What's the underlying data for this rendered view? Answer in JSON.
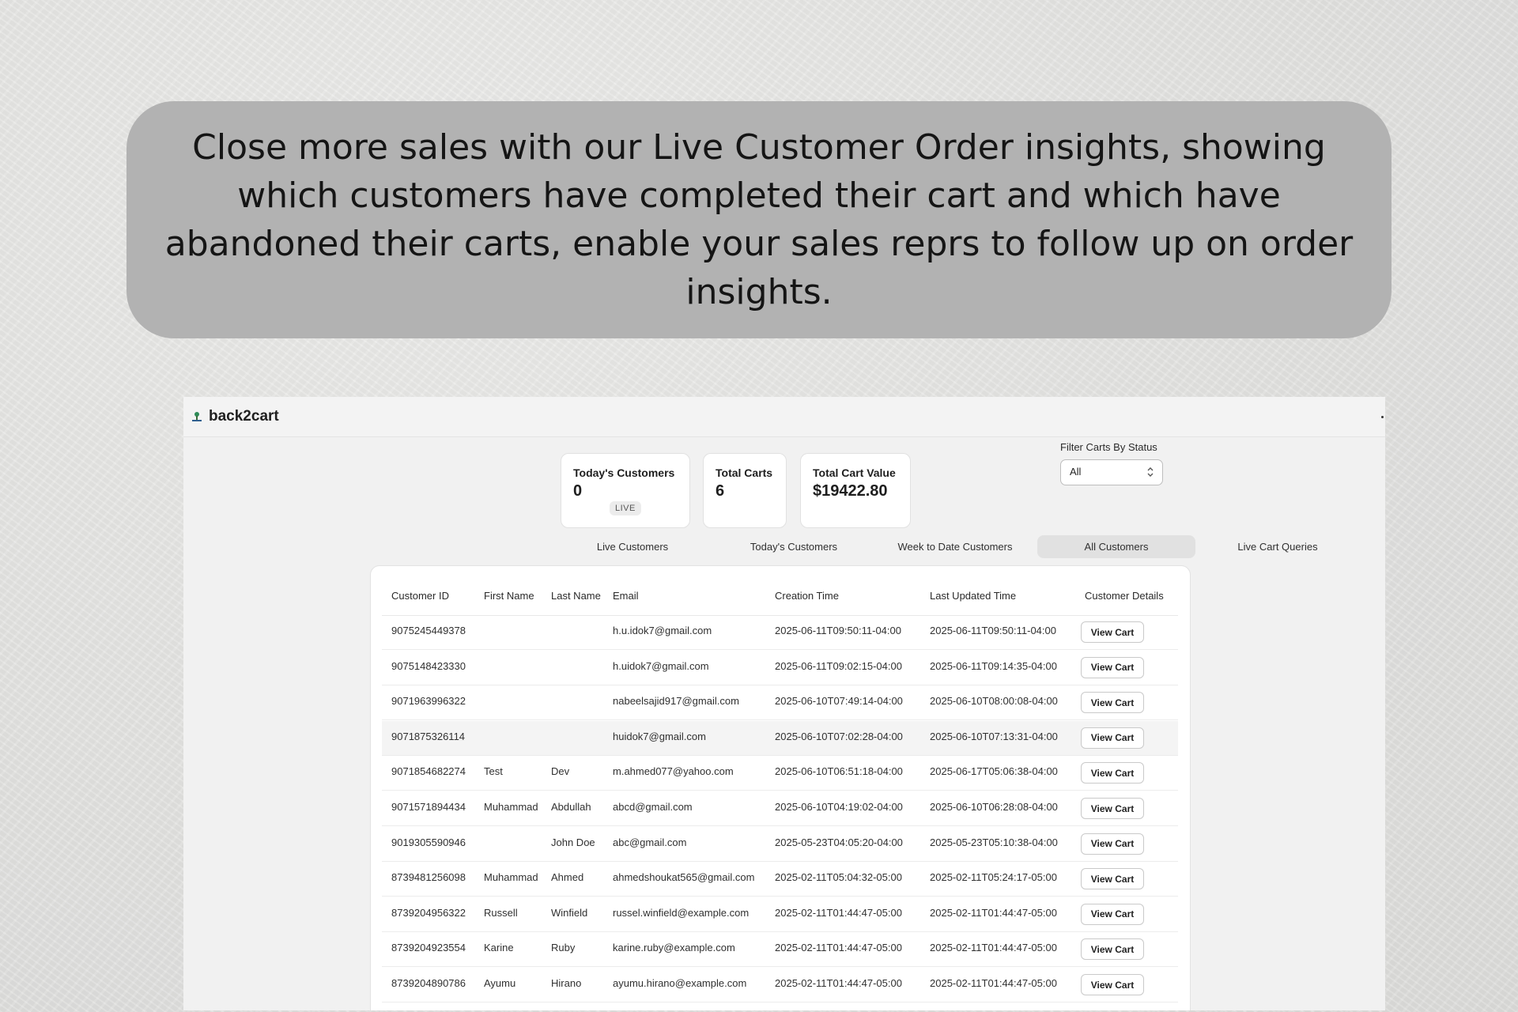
{
  "banner": {
    "text": "Close more sales with our Live Customer Order insights, showing which customers have completed their cart and which have abandoned their carts, enable your sales reprs to follow up on order insights."
  },
  "app": {
    "name": "back2cart",
    "stats": {
      "todays_customers_label": "Today's Customers",
      "todays_customers_value": "0",
      "live_badge": "LIVE",
      "total_carts_label": "Total Carts",
      "total_carts_value": "6",
      "total_cart_value_label": "Total Cart Value",
      "total_cart_value_value": "$19422.80"
    },
    "filter": {
      "label": "Filter Carts By Status",
      "selected": "All"
    },
    "tabs": [
      {
        "label": "Live Customers",
        "active": false
      },
      {
        "label": "Today's Customers",
        "active": false
      },
      {
        "label": "Week to Date Customers",
        "active": false
      },
      {
        "label": "All Customers",
        "active": true
      },
      {
        "label": "Live Cart Queries",
        "active": false
      }
    ],
    "table": {
      "columns": [
        "Customer ID",
        "First Name",
        "Last Name",
        "Email",
        "Creation Time",
        "Last Updated Time",
        "Customer Details"
      ],
      "button_label": "View Cart",
      "rows": [
        {
          "id": "9075245449378",
          "first": "",
          "last": "",
          "email": "h.u.idok7@gmail.com",
          "created": "2025-06-11T09:50:11-04:00",
          "updated": "2025-06-11T09:50:11-04:00"
        },
        {
          "id": "9075148423330",
          "first": "",
          "last": "",
          "email": "h.uidok7@gmail.com",
          "created": "2025-06-11T09:02:15-04:00",
          "updated": "2025-06-11T09:14:35-04:00"
        },
        {
          "id": "9071963996322",
          "first": "",
          "last": "",
          "email": "nabeelsajid917@gmail.com",
          "created": "2025-06-10T07:49:14-04:00",
          "updated": "2025-06-10T08:00:08-04:00"
        },
        {
          "id": "9071875326114",
          "first": "",
          "last": "",
          "email": "huidok7@gmail.com",
          "created": "2025-06-10T07:02:28-04:00",
          "updated": "2025-06-10T07:13:31-04:00"
        },
        {
          "id": "9071854682274",
          "first": "Test",
          "last": "Dev",
          "email": "m.ahmed077@yahoo.com",
          "created": "2025-06-10T06:51:18-04:00",
          "updated": "2025-06-17T05:06:38-04:00"
        },
        {
          "id": "9071571894434",
          "first": "Muhammad",
          "last": "Abdullah",
          "email": "abcd@gmail.com",
          "created": "2025-06-10T04:19:02-04:00",
          "updated": "2025-06-10T06:28:08-04:00"
        },
        {
          "id": "9019305590946",
          "first": "",
          "last": "John Doe",
          "email": "abc@gmail.com",
          "created": "2025-05-23T04:05:20-04:00",
          "updated": "2025-05-23T05:10:38-04:00"
        },
        {
          "id": "8739481256098",
          "first": "Muhammad",
          "last": "Ahmed",
          "email": "ahmedshoukat565@gmail.com",
          "created": "2025-02-11T05:04:32-05:00",
          "updated": "2025-02-11T05:24:17-05:00"
        },
        {
          "id": "8739204956322",
          "first": "Russell",
          "last": "Winfield",
          "email": "russel.winfield@example.com",
          "created": "2025-02-11T01:44:47-05:00",
          "updated": "2025-02-11T01:44:47-05:00"
        },
        {
          "id": "8739204923554",
          "first": "Karine",
          "last": "Ruby",
          "email": "karine.ruby@example.com",
          "created": "2025-02-11T01:44:47-05:00",
          "updated": "2025-02-11T01:44:47-05:00"
        },
        {
          "id": "8739204890786",
          "first": "Ayumu",
          "last": "Hirano",
          "email": "ayumu.hirano@example.com",
          "created": "2025-02-11T01:44:47-05:00",
          "updated": "2025-02-11T01:44:47-05:00"
        }
      ]
    }
  }
}
